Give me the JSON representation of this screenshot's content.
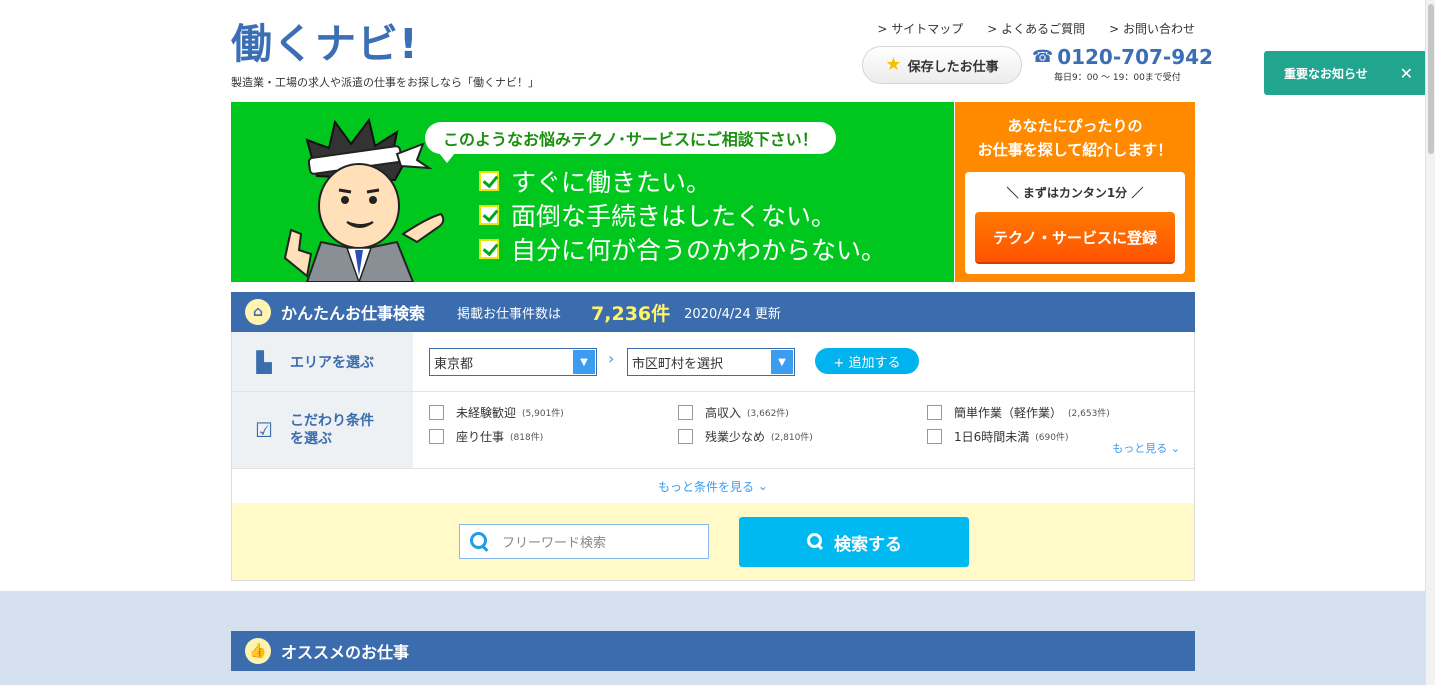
{
  "header": {
    "logo": "働くナビ!",
    "tagline": "製造業・工場の求人や派遣の仕事をお探しなら「働くナビ！」",
    "links": [
      "サイトマップ",
      "よくあるご質問",
      "お問い合わせ"
    ],
    "saved_jobs": "保存したお仕事",
    "phone": "0120-707-942",
    "hours": "毎日9：00 〜 19：00まで受付"
  },
  "notice": {
    "label": "重要なお知らせ"
  },
  "banner": {
    "bubble": "このようなお悩みテクノ･サービスにご相談下さい！",
    "checks": [
      "すぐに働きたい。",
      "面倒な手続きはしたくない。",
      "自分に何が合うのかわからない。"
    ],
    "side_title_1": "あなたにぴったりの",
    "side_title_2": "お仕事を探して紹介します！",
    "side_sub": "まずはカンタン1分",
    "register": "テクノ・サービスに登録"
  },
  "search": {
    "title": "かんたんお仕事検索",
    "count_label": "掲載お仕事件数は",
    "count": "7,236件",
    "updated": "2020/4/24 更新",
    "area_label": "エリアを選ぶ",
    "prefecture": "東京都",
    "city": "市区町村を選択",
    "add": "+ 追加する",
    "cond_label_1": "こだわり条件",
    "cond_label_2": "を選ぶ",
    "conditions": [
      {
        "label": "未経験歓迎",
        "count": "(5,901件)"
      },
      {
        "label": "高収入",
        "count": "(3,662件)"
      },
      {
        "label": "簡単作業（軽作業）",
        "count": "(2,653件)"
      },
      {
        "label": "座り仕事",
        "count": "(818件)"
      },
      {
        "label": "残業少なめ",
        "count": "(2,810件)"
      },
      {
        "label": "1日6時間未満",
        "count": "(690件)"
      }
    ],
    "more": "もっと見る",
    "more_conditions": "もっと条件を見る",
    "freeword_placeholder": "フリーワード検索",
    "submit": "検索する"
  },
  "recommend": {
    "title": "オススメのお仕事"
  },
  "colors": {
    "brand_blue": "#3b6cad",
    "banner_green": "#00c71e",
    "cta_orange": "#ff6a00",
    "search_cyan": "#00b9f0",
    "notice_teal": "#21a58f"
  }
}
